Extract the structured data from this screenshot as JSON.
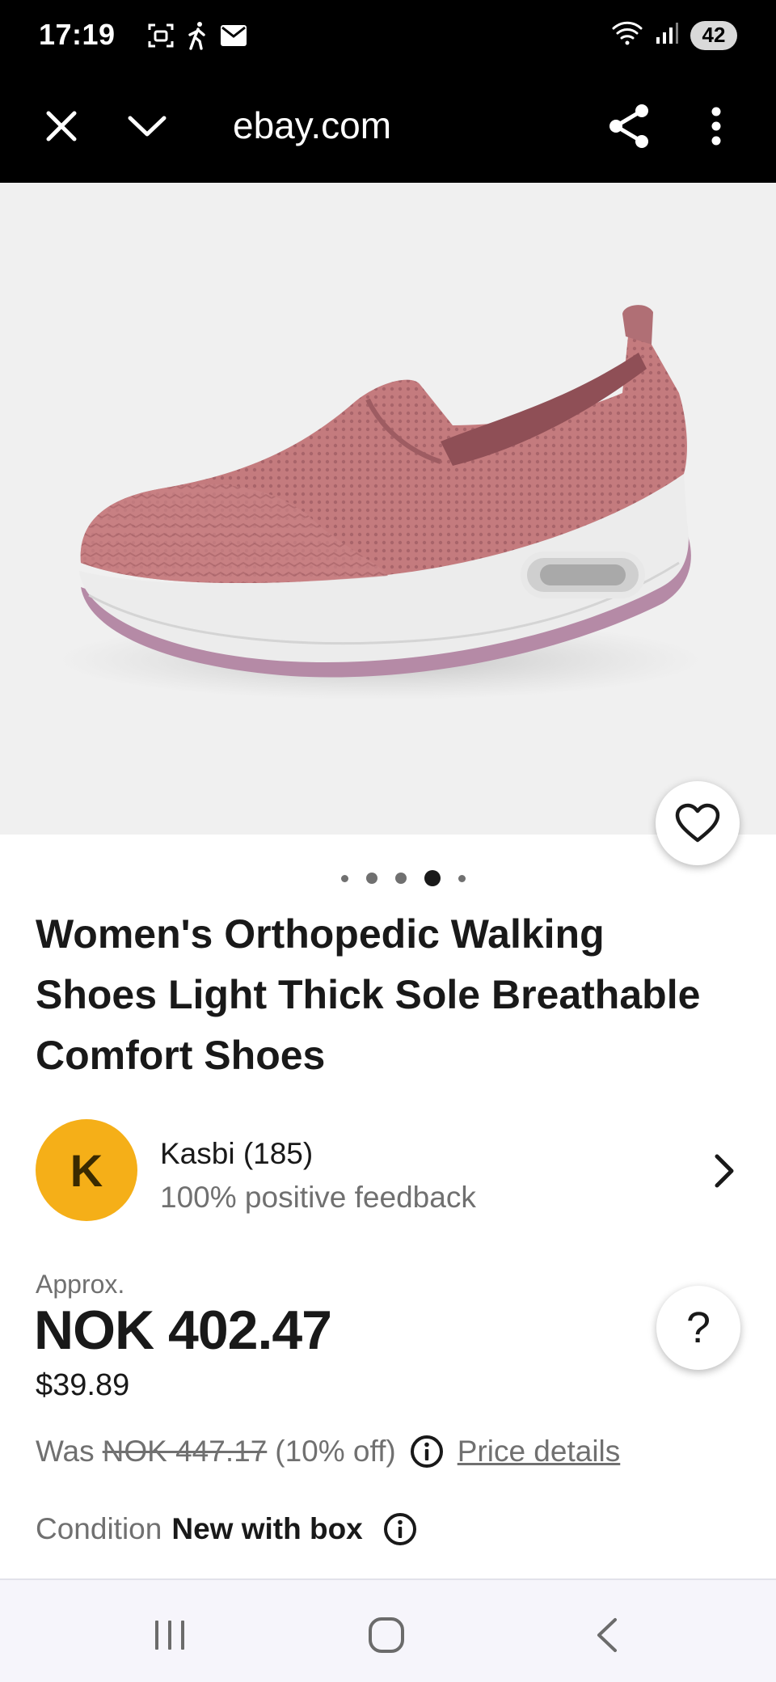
{
  "status_bar": {
    "time": "17:19",
    "battery": "42",
    "icons": [
      "screenshot-icon",
      "walking-icon",
      "mail-icon",
      "wifi-icon",
      "signal-icon",
      "battery-icon"
    ]
  },
  "browser": {
    "url": "ebay.com",
    "icons": [
      "close-icon",
      "chevron-down-icon",
      "share-icon",
      "more-vertical-icon"
    ]
  },
  "product": {
    "image": "pink-knit-slip-on-shoe-photo",
    "title": "Women's Orthopedic Walking Shoes Light Thick Sole Breathable Comfort Shoes",
    "carousel": {
      "total": 5,
      "active_index": 3
    }
  },
  "seller": {
    "initial": "K",
    "name": "Kasbi (185)",
    "feedback": "100% positive feedback",
    "avatar_color": "#f5af18"
  },
  "price": {
    "approx_label": "Approx.",
    "amount": "NOK 402.47",
    "converted": "$39.89",
    "was_label": "Was",
    "was_amount": "NOK 447.17",
    "discount": "(10% off)",
    "details_link": "Price details",
    "help": "?"
  },
  "condition": {
    "label": "Condition",
    "value": "New with box"
  },
  "colors": {
    "text_primary": "#191919",
    "text_secondary": "#707070",
    "shoe_knit": "#c47b7e",
    "sole": "#ececec",
    "sole_trim": "#b58aa6"
  }
}
